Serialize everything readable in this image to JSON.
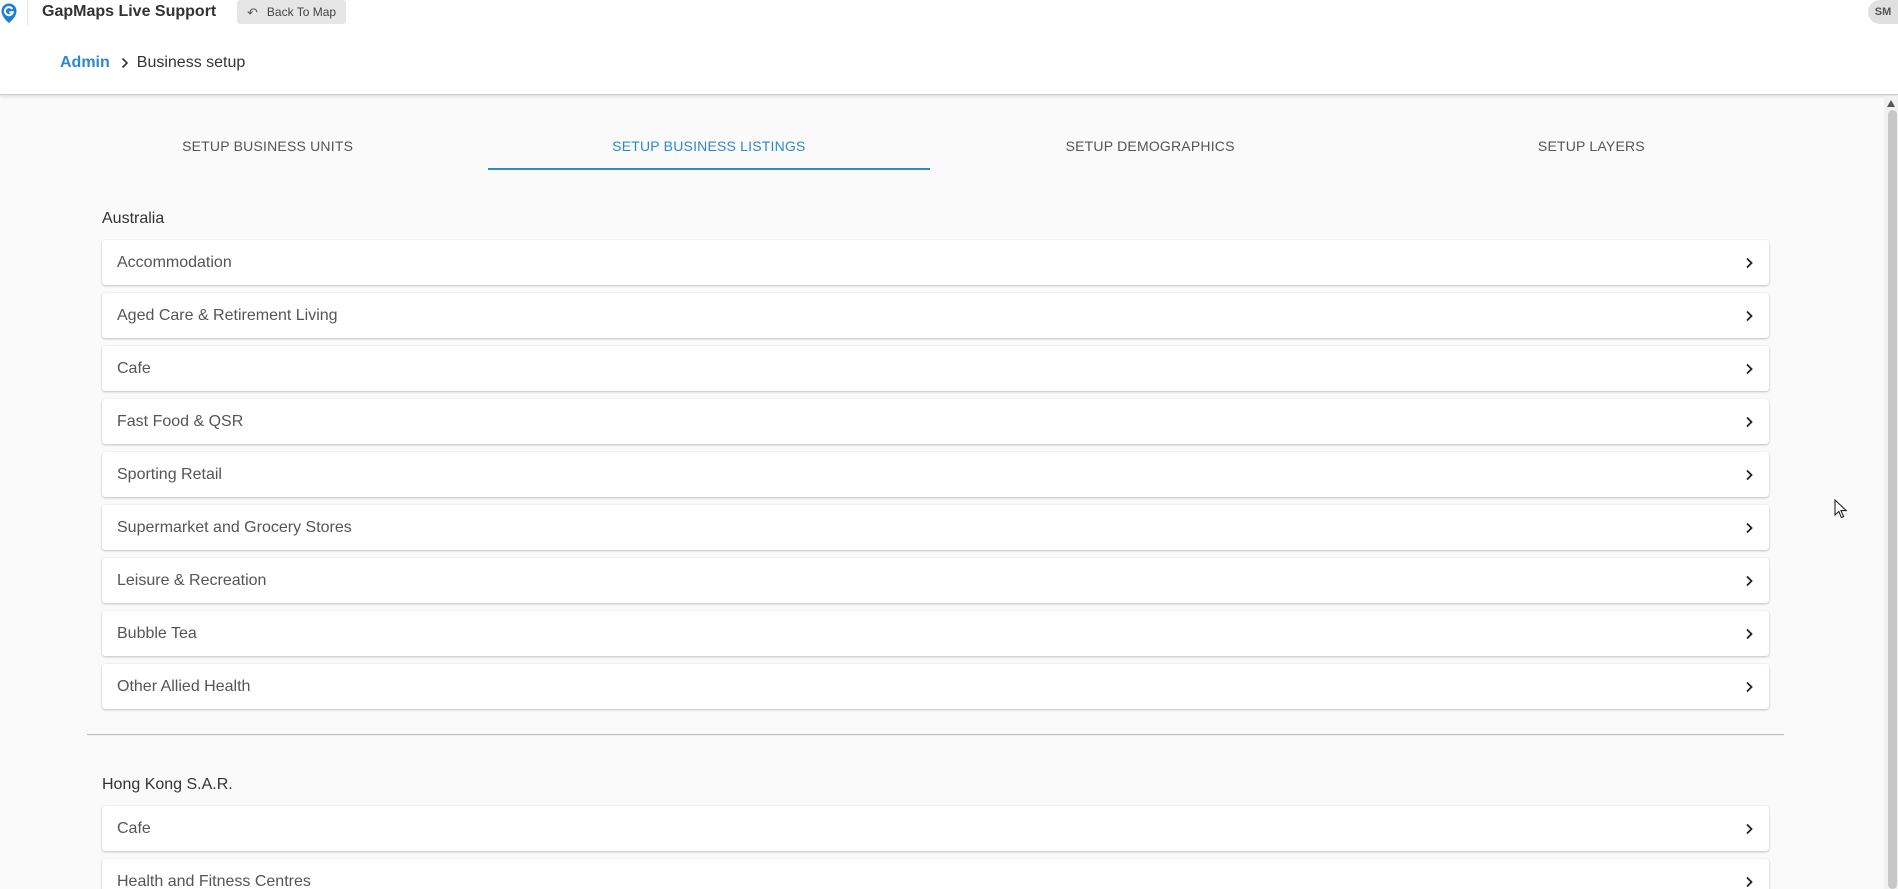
{
  "header": {
    "app_title": "GapMaps Live Support",
    "back_button_label": "Back To Map",
    "avatar_initials": "SM"
  },
  "breadcrumb": {
    "parent": "Admin",
    "current": "Business setup"
  },
  "tabs": [
    {
      "label": "SETUP BUSINESS UNITS",
      "active": false
    },
    {
      "label": "SETUP BUSINESS LISTINGS",
      "active": true
    },
    {
      "label": "SETUP DEMOGRAPHICS",
      "active": false
    },
    {
      "label": "SETUP LAYERS",
      "active": false
    }
  ],
  "sections": [
    {
      "country": "Australia",
      "items": [
        "Accommodation",
        "Aged Care & Retirement Living",
        "Cafe",
        "Fast Food & QSR",
        "Sporting Retail",
        "Supermarket and Grocery Stores",
        "Leisure & Recreation",
        "Bubble Tea",
        "Other Allied Health"
      ]
    },
    {
      "country": "Hong Kong S.A.R.",
      "items": [
        "Cafe",
        "Health and Fitness Centres"
      ]
    }
  ],
  "colors": {
    "accent": "#2f88c9",
    "logo": "#1e7fd8"
  },
  "icons": {
    "logo": "gapmaps-logo",
    "back": "undo-arrow-icon",
    "row_chevron": "chevron-right-icon"
  }
}
